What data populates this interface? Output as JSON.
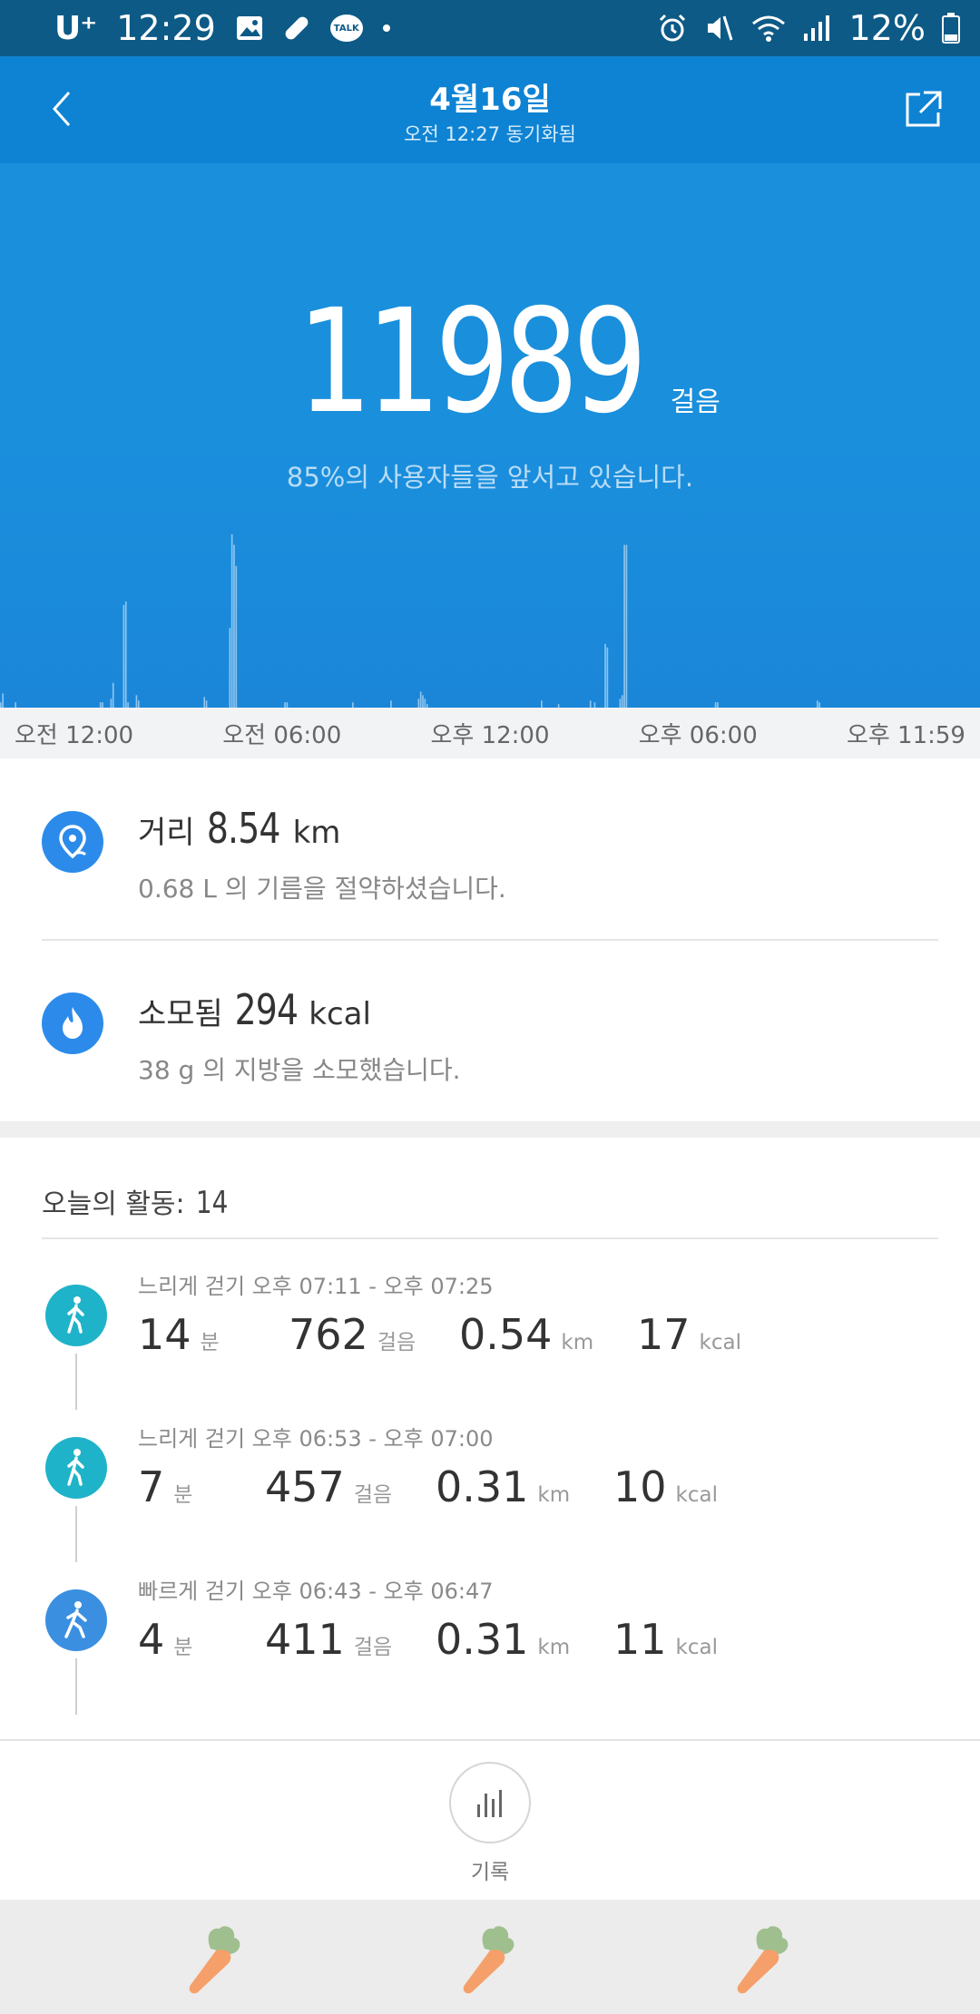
{
  "status_bar": {
    "carrier": "U⁺",
    "time": "12:29",
    "battery": "12%"
  },
  "header": {
    "title": "4월16일",
    "subtitle": "오전 12:27 동기화됨"
  },
  "steps": {
    "count": "11989",
    "unit": "걸음",
    "rank_text": "85%의 사용자들을 앞서고 있습니다."
  },
  "time_axis": [
    "오전 12:00",
    "오전 06:00",
    "오후 12:00",
    "오후 06:00",
    "오후 11:59"
  ],
  "chart_data": {
    "type": "bar",
    "title": "",
    "xlabel": "",
    "ylabel": "",
    "x_range": [
      "오전 12:00",
      "오후 11:59"
    ],
    "values": [
      3,
      8,
      0,
      0,
      0,
      0,
      0,
      3,
      0,
      0,
      0,
      0,
      0,
      0,
      0,
      0,
      0,
      0,
      0,
      0,
      0,
      0,
      0,
      0,
      0,
      0,
      0,
      0,
      0,
      0,
      0,
      0,
      0,
      0,
      0,
      0,
      0,
      0,
      0,
      0,
      0,
      0,
      0,
      0,
      0,
      0,
      0,
      3,
      3,
      0,
      0,
      0,
      5,
      14,
      0,
      0,
      0,
      0,
      58,
      60,
      3,
      0,
      0,
      0,
      7,
      4,
      0,
      0,
      0,
      0,
      0,
      0,
      0,
      0,
      0,
      0,
      0,
      0,
      0,
      0,
      0,
      0,
      0,
      0,
      0,
      0,
      0,
      0,
      0,
      0,
      0,
      0,
      0,
      0,
      0,
      0,
      6,
      4,
      0,
      0,
      0,
      0,
      0,
      0,
      0,
      0,
      0,
      0,
      45,
      98,
      92,
      80,
      0,
      0,
      0,
      0,
      0,
      0,
      0,
      0,
      0,
      0,
      0,
      0,
      0,
      0,
      0,
      0,
      0,
      0,
      0,
      0,
      0,
      0,
      3,
      3,
      0,
      0,
      0,
      0,
      0,
      0,
      0,
      0,
      0,
      0,
      0,
      0,
      0,
      0,
      0,
      0,
      0,
      0,
      0,
      0,
      0,
      0,
      0,
      0,
      0,
      0,
      0,
      0,
      0,
      0,
      3,
      0,
      0,
      0,
      0,
      0,
      0,
      0,
      0,
      0,
      0,
      0,
      0,
      0,
      0,
      0,
      0,
      0,
      4,
      0,
      0,
      0,
      0,
      0,
      0,
      0,
      0,
      0,
      0,
      0,
      0,
      5,
      9,
      7,
      5,
      2,
      0,
      0,
      0,
      0,
      0,
      0,
      0,
      0,
      0,
      0,
      0,
      0,
      0,
      0,
      0,
      0,
      0,
      0,
      0,
      0,
      0,
      0,
      0,
      0,
      0,
      0,
      0,
      0,
      0,
      0,
      0,
      0,
      0,
      0,
      0,
      0,
      0,
      0,
      0,
      0,
      0,
      0,
      0,
      0,
      0,
      0,
      0,
      0,
      0,
      0,
      0,
      0,
      0,
      4,
      0,
      0,
      0,
      0,
      0,
      0,
      0,
      2,
      0,
      0,
      0,
      0,
      0,
      0,
      0,
      0,
      0,
      0,
      0,
      0,
      0,
      0,
      4,
      0,
      3,
      0,
      0,
      0,
      0,
      36,
      34,
      0,
      0,
      0,
      0,
      0,
      5,
      7,
      92,
      92,
      0,
      0,
      0,
      0,
      0,
      0,
      0,
      0,
      0,
      0,
      0,
      0,
      0,
      0,
      0,
      0,
      0,
      0,
      0,
      0,
      0,
      0,
      0,
      0,
      0,
      0,
      0,
      0,
      0,
      0,
      0,
      0,
      0,
      0,
      0,
      0,
      0,
      0,
      0,
      0,
      0,
      3,
      3,
      0,
      0,
      0,
      0,
      0,
      0,
      0,
      0,
      0,
      0,
      0,
      0,
      0,
      0,
      0,
      0,
      0,
      0,
      0,
      0,
      0,
      0,
      0,
      0,
      0,
      0,
      0,
      0,
      0,
      0,
      0,
      0,
      0,
      0,
      0,
      0,
      0,
      0,
      0,
      0,
      0,
      0,
      0,
      0,
      0,
      0,
      4,
      3,
      0,
      0,
      0,
      0,
      0,
      0,
      0,
      0,
      0,
      0,
      0,
      0,
      0,
      0,
      0,
      0,
      0,
      0,
      0,
      0,
      0,
      0,
      0,
      0,
      0,
      0,
      0,
      0,
      0,
      0,
      0,
      0,
      0,
      0,
      0,
      0,
      0,
      0,
      0,
      0,
      0,
      0,
      0,
      0,
      0,
      0,
      0,
      0,
      0,
      0,
      0,
      0,
      0,
      0,
      0,
      0,
      0,
      0,
      0,
      0,
      0,
      0,
      0,
      0,
      0,
      0,
      0,
      0,
      0,
      0,
      0,
      0,
      0,
      0,
      0
    ]
  },
  "summary": {
    "distance": {
      "label": "거리",
      "value": "8.54",
      "unit": "km",
      "sub": "0.68 L 의 기름을 절약하셨습니다."
    },
    "calories": {
      "label": "소모됨",
      "value": "294",
      "unit": "kcal",
      "sub": "38 g 의 지방을 소모했습니다."
    }
  },
  "activities": {
    "header": "오늘의 활동:",
    "count": "14",
    "items": [
      {
        "label": "느리게 걷기 오후 07:11 - 오후 07:25",
        "minutes": "14",
        "min_unit": "분",
        "steps": "762",
        "steps_unit": "걸음",
        "distance": "0.54",
        "dist_unit": "km",
        "kcal": "17",
        "kcal_unit": "kcal",
        "color": "#1fb3c9"
      },
      {
        "label": "느리게 걷기 오후 06:53 - 오후 07:00",
        "minutes": "7",
        "min_unit": "분",
        "steps": "457",
        "steps_unit": "걸음",
        "distance": "0.31",
        "dist_unit": "km",
        "kcal": "10",
        "kcal_unit": "kcal",
        "color": "#1fb3c9"
      },
      {
        "label": "빠르게 걷기 오후 06:43 - 오후 06:47",
        "minutes": "4",
        "min_unit": "분",
        "steps": "411",
        "steps_unit": "걸음",
        "distance": "0.31",
        "dist_unit": "km",
        "kcal": "11",
        "kcal_unit": "kcal",
        "color": "#3b8fe0"
      }
    ]
  },
  "record": {
    "label": "기록"
  },
  "colors": {
    "accent": "#1a8fdc",
    "status_bar": "#0d5a86",
    "bar": "#8ec5f0"
  }
}
